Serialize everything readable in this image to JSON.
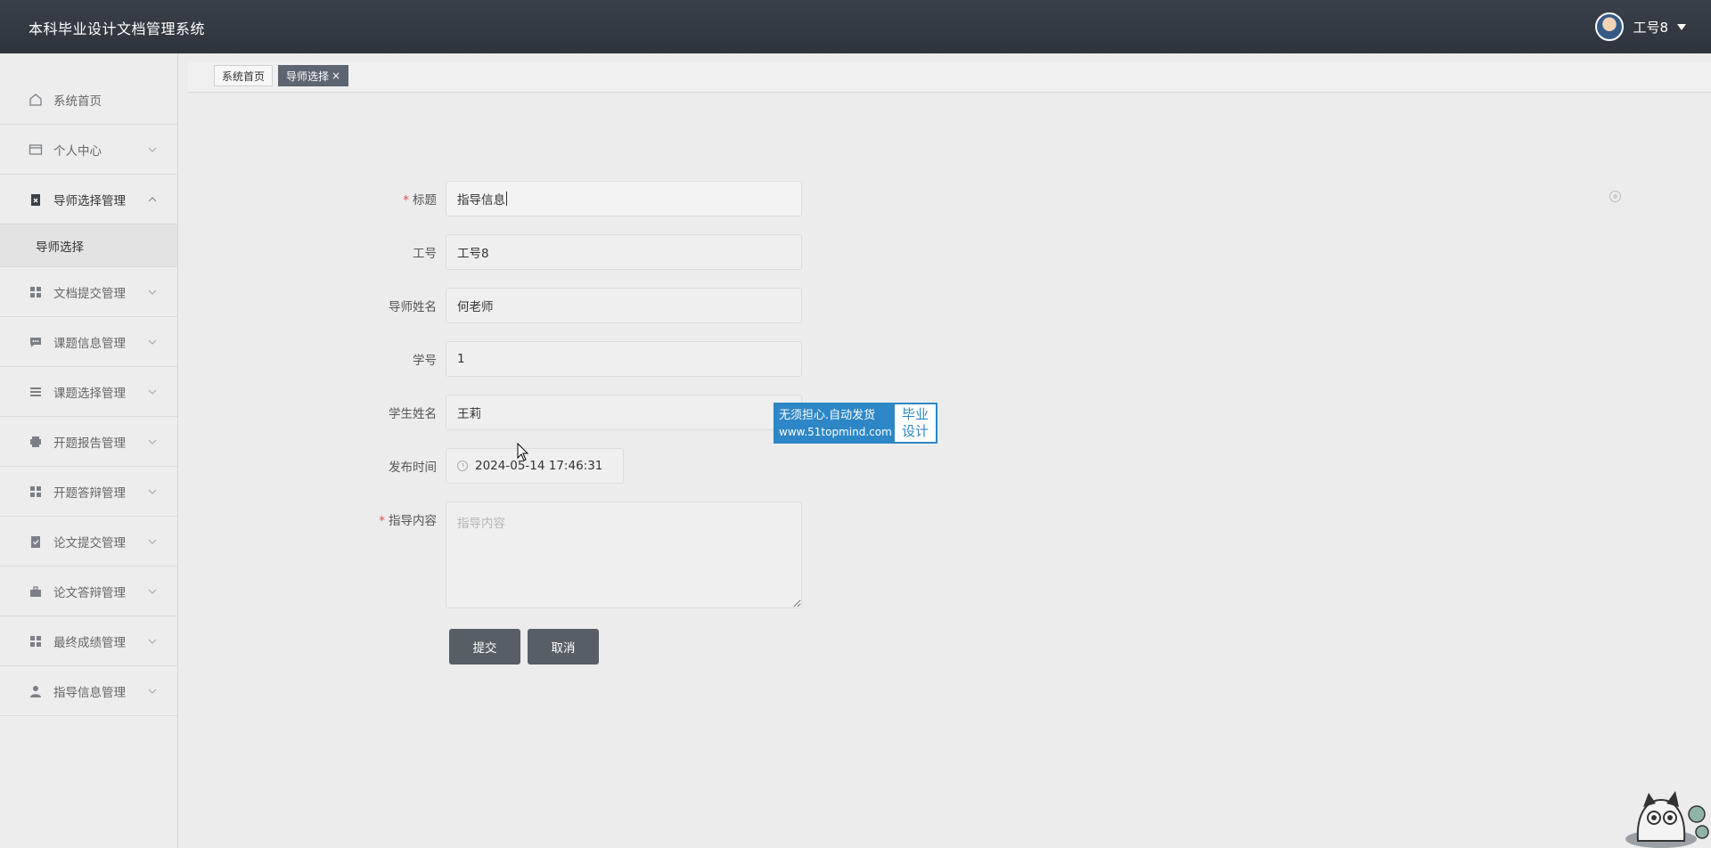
{
  "header": {
    "title": "本科毕业设计文档管理系统",
    "user_name": "工号8"
  },
  "sidebar": {
    "items": [
      {
        "label": "系统首页",
        "icon": "home-icon"
      },
      {
        "label": "个人中心",
        "icon": "card-icon"
      },
      {
        "label": "导师选择管理",
        "icon": "clipboard-icon",
        "expanded": true
      },
      {
        "label": "文档提交管理",
        "icon": "grid-icon"
      },
      {
        "label": "课题信息管理",
        "icon": "chat-icon"
      },
      {
        "label": "课题选择管理",
        "icon": "list-icon"
      },
      {
        "label": "开题报告管理",
        "icon": "printer-icon"
      },
      {
        "label": "开题答辩管理",
        "icon": "grid-icon"
      },
      {
        "label": "论文提交管理",
        "icon": "checklist-icon"
      },
      {
        "label": "论文答辩管理",
        "icon": "briefcase-icon"
      },
      {
        "label": "最终成绩管理",
        "icon": "grid-icon"
      },
      {
        "label": "指导信息管理",
        "icon": "user-icon"
      }
    ],
    "submenu": {
      "label": "导师选择"
    }
  },
  "tabs": [
    {
      "label": "系统首页"
    },
    {
      "label": "导师选择",
      "close": "×"
    }
  ],
  "form": {
    "title": {
      "label": "标题",
      "value": "指导信息"
    },
    "staff_id": {
      "label": "工号",
      "value": "工号8"
    },
    "advisor_name": {
      "label": "导师姓名",
      "value": "何老师"
    },
    "student_id": {
      "label": "学号",
      "value": "1"
    },
    "student_name": {
      "label": "学生姓名",
      "value": "王莉"
    },
    "publish_time": {
      "label": "发布时间",
      "value": "2024-05-14 17:46:31"
    },
    "content": {
      "label": "指导内容",
      "placeholder": "指导内容"
    },
    "required_mark": "*",
    "submit_label": "提交",
    "cancel_label": "取消"
  },
  "watermark": {
    "line1": "无须担心.自动发货",
    "line2": "www.51topmind.com",
    "right1": "毕业",
    "right2": "设计"
  },
  "colors": {
    "header_bg": "#353b44",
    "button_bg": "#575e66",
    "active_tab": "#5c6571",
    "required": "#e34d4d",
    "watermark_blue": "#2d86c6"
  }
}
